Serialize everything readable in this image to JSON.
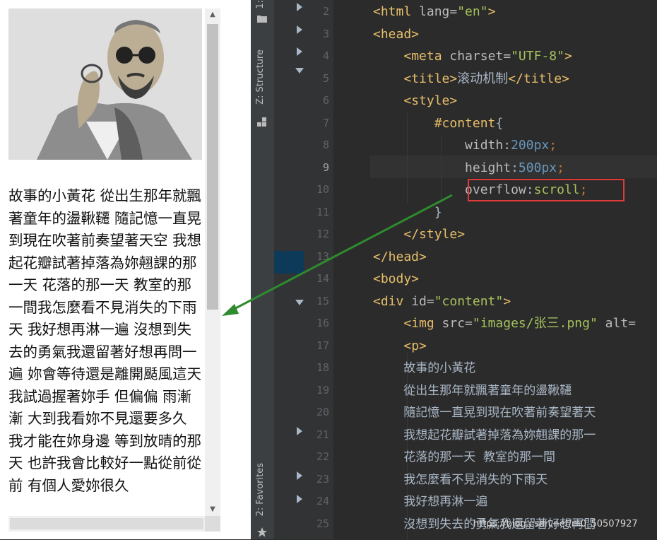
{
  "preview": {
    "poem_text": "故事的小黃花 從出生那年就飄著童年的盪鞦韆 隨記憶一直晃到現在吹著前奏望著天空 我想起花瓣試著掉落為妳翹課的那一天 花落的那一天 教室的那一間我怎麼看不見消失的下雨天 我好想再淋一遍 沒想到失去的勇氣我還留著好想再問一遍 妳會等待還是離開颳風這天 我試過握著妳手 但偏偏 雨漸漸 大到我看妳不見還要多久 我才能在妳身邊 等到放晴的那天 也許我會比較好一點從前從前 有個人愛妳很久",
    "scroll_up": "▲",
    "scroll_down": "▼"
  },
  "toolstrip": {
    "top_tab": "1:",
    "structure_tab": "Z: Structure",
    "favorites_tab": "2: Favorites"
  },
  "editor": {
    "lines": [
      {
        "n": "2",
        "html": "<span class='tag'>&lt;html </span><span class='attr'>lang=</span><span class='str'>\"en\"</span><span class='tag'>&gt;</span>"
      },
      {
        "n": "3",
        "html": "<span class='tag'>&lt;head&gt;</span>"
      },
      {
        "n": "4",
        "html": "    <span class='tag'>&lt;meta </span><span class='attr'>charset=</span><span class='str'>\"UTF-8\"</span><span class='tag'>&gt;</span>"
      },
      {
        "n": "5",
        "html": "    <span class='tag'>&lt;title&gt;</span>滚动机制<span class='tag'>&lt;/title&gt;</span>"
      },
      {
        "n": "6",
        "html": "    <span class='tag'>&lt;style&gt;</span>"
      },
      {
        "n": "7",
        "html": "        <span class='sel'>#content</span>{"
      },
      {
        "n": "8",
        "html": "            <span class='prop'>width</span>:<span class='num'>200</span><span class='num'>px</span><span class='kw'>;</span>"
      },
      {
        "n": "9",
        "html": "            <span class='prop'>height</span>:<span class='num'>500</span><span class='num'>px</span><span class='kw'>;</span>"
      },
      {
        "n": "10",
        "html": "            <span class='prop'>overflow</span>:<span class='str'>scroll</span><span class='kw'>;</span>"
      },
      {
        "n": "11",
        "html": "        }"
      },
      {
        "n": "12",
        "html": "    <span class='tag'>&lt;/style&gt;</span>"
      },
      {
        "n": "13",
        "html": "<span class='tag'>&lt;/head&gt;</span>"
      },
      {
        "n": "14",
        "html": "<span class='tag'>&lt;body&gt;</span>"
      },
      {
        "n": "15",
        "html": "<span class='tag'>&lt;div </span><span class='attr'>id=</span><span class='str'>\"content\"</span><span class='tag'>&gt;</span>"
      },
      {
        "n": "16",
        "html": "    <span class='tag'>&lt;img </span><span class='attr'>src=</span><span class='str'>\"images/张三.png\"</span> <span class='attr'>alt=</span>"
      },
      {
        "n": "17",
        "html": "    <span class='tag'>&lt;p&gt;</span>"
      },
      {
        "n": "18",
        "html": "        故事的小黃花"
      },
      {
        "n": "19",
        "html": "        從出生那年就飄著童年的盪鞦韆"
      },
      {
        "n": "20",
        "html": "        隨記憶一直晃到現在吹著前奏望著天"
      },
      {
        "n": "21",
        "html": "        我想起花瓣試著掉落為妳翹課的那一"
      },
      {
        "n": "22",
        "html": "        花落的那一天  教室的那一間"
      },
      {
        "n": "23",
        "html": "        我怎麼看不見消失的下雨天"
      },
      {
        "n": "24",
        "html": "        我好想再淋一遍"
      },
      {
        "n": "25",
        "html": "        沒想到失去的勇氣我還留著好想再問"
      }
    ],
    "watermark": "https://blog.csdn.net/m0_50507927"
  }
}
